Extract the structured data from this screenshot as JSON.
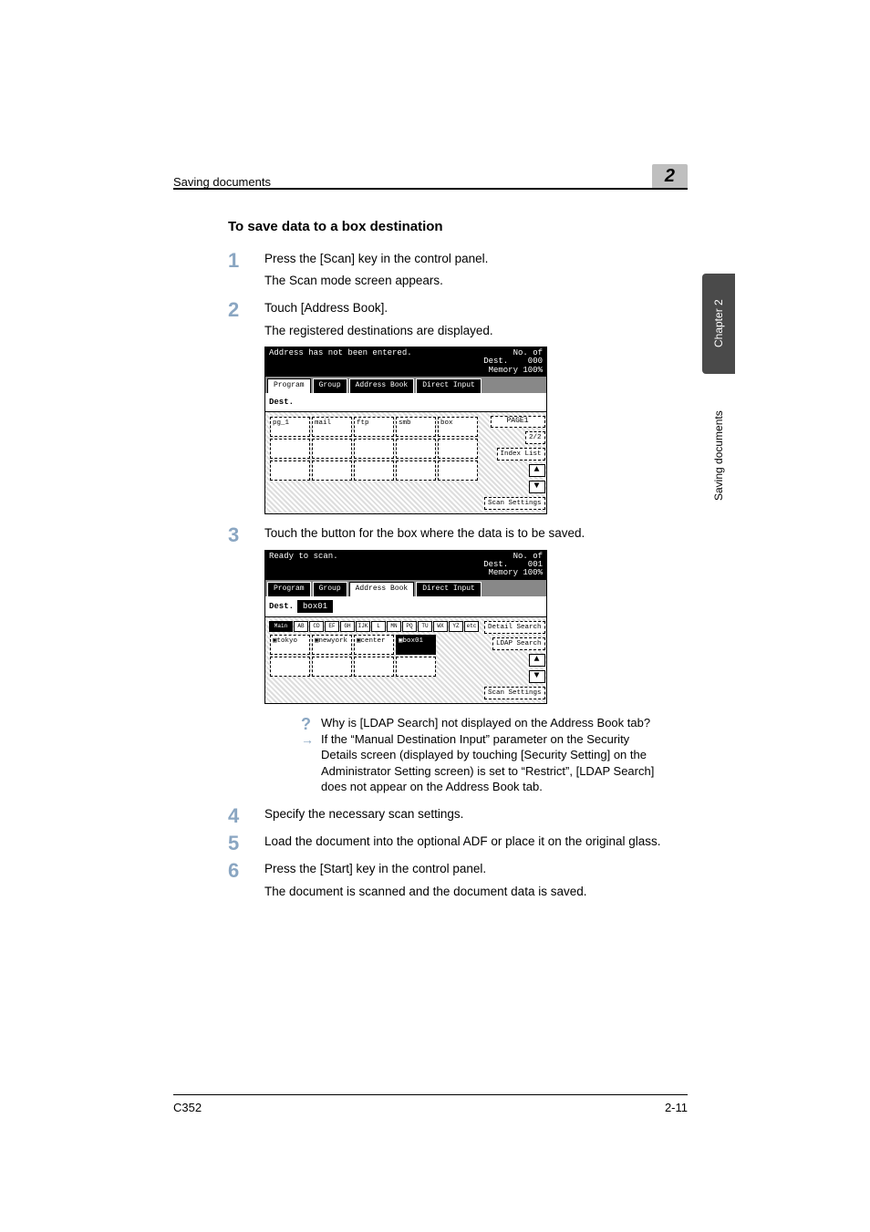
{
  "running_head": {
    "left": "Saving documents",
    "right": "2"
  },
  "side_tabs": {
    "dark": "Chapter 2",
    "light": "Saving documents"
  },
  "section_title": "To save data to a box destination",
  "steps": [
    {
      "num": "1",
      "main": "Press the [Scan] key in the control panel.",
      "sub": "The Scan mode screen appears."
    },
    {
      "num": "2",
      "main": "Touch [Address Book].",
      "sub": "The registered destinations are displayed."
    },
    {
      "num": "3",
      "main": "Touch the button for the box where the data is to be saved."
    },
    {
      "num": "4",
      "main": "Specify the necessary scan settings."
    },
    {
      "num": "5",
      "main": "Load the document into the optional ADF or place it on the original glass."
    },
    {
      "num": "6",
      "main": "Press the [Start] key in the control panel.",
      "sub": "The document is scanned and the document data is saved."
    }
  ],
  "screenshot1": {
    "top_left": "Address has not been entered.",
    "top_right": "No. of\nDest.    000\nMemory 100%",
    "tabs": [
      "Program",
      "Group",
      "Address Book",
      "Direct Input"
    ],
    "active_tab": 0,
    "dest_label": "Dest.",
    "dest_value": "",
    "cells": [
      "pg_1",
      "mail",
      "ftp",
      "smb",
      "box"
    ],
    "side": {
      "page": "PAGE1",
      "page_counter": "2/2",
      "index": "Index List",
      "scan": "Scan Settings"
    }
  },
  "screenshot2": {
    "top_left": "Ready to scan.",
    "top_right": "No. of\nDest.    001\nMemory 100%",
    "tabs": [
      "Program",
      "Group",
      "Address Book",
      "Direct Input"
    ],
    "active_tab": 2,
    "dest_label": "Dest.",
    "dest_value": "box01",
    "index_tabs": [
      "Main",
      "AB",
      "CD",
      "EF",
      "GH",
      "IJK",
      "L",
      "MN",
      "PQ",
      "TU",
      "WX",
      "YZ",
      "etc"
    ],
    "cells": [
      {
        "label": "▣tokyo",
        "sel": false
      },
      {
        "label": "▣newyork",
        "sel": false
      },
      {
        "label": "▣center",
        "sel": false
      },
      {
        "label": "▣box01",
        "sel": true
      }
    ],
    "side": {
      "detail": "Detail Search",
      "ldap": "LDAP Search",
      "scan": "Scan Settings"
    }
  },
  "qa": {
    "q": "Why is [LDAP Search] not displayed on the Address Book tab?",
    "a": "If the “Manual Destination Input” parameter on the Security Details screen (displayed by touching [Security Setting] on the Administrator Setting screen) is set to “Restrict”, [LDAP Search] does not appear on the Address Book tab."
  },
  "footer": {
    "left": "C352",
    "right": "2-11"
  }
}
